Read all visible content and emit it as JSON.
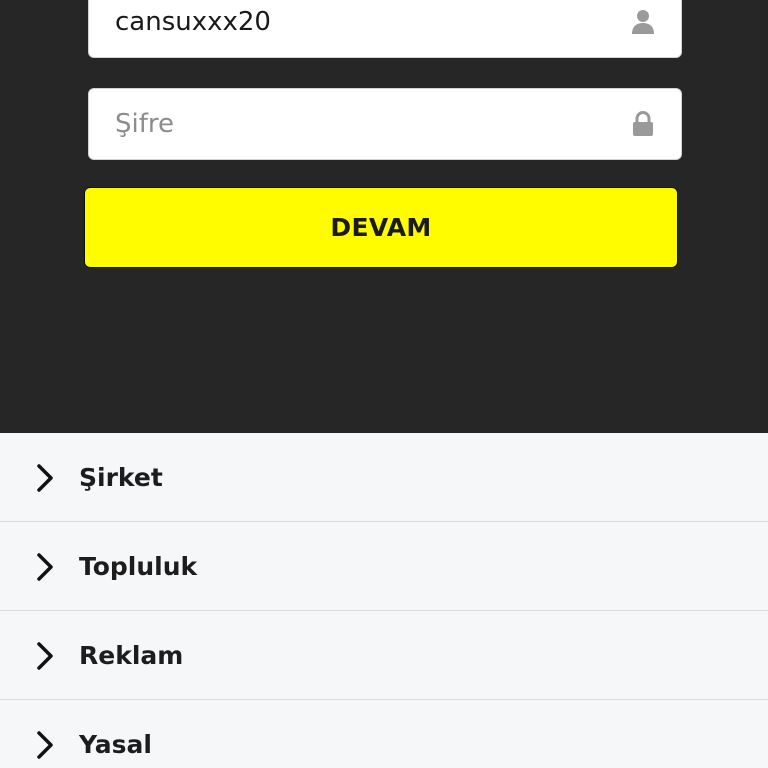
{
  "login": {
    "username_value": "cansuxxx20",
    "password_placeholder": "Şifre",
    "continue_label": "DEVAM",
    "username_icon": "user-icon",
    "password_icon": "lock-icon"
  },
  "menu": {
    "items": [
      {
        "label": "Şirket",
        "icon": "chevron-right-icon"
      },
      {
        "label": "Topluluk",
        "icon": "chevron-right-icon"
      },
      {
        "label": "Reklam",
        "icon": "chevron-right-icon"
      },
      {
        "label": "Yasal",
        "icon": "chevron-right-icon"
      }
    ]
  },
  "colors": {
    "panel_background": "#262626",
    "cta_yellow": "#fffc00",
    "menu_background": "#f6f7f9",
    "icon_gray": "#9a9a9a"
  }
}
